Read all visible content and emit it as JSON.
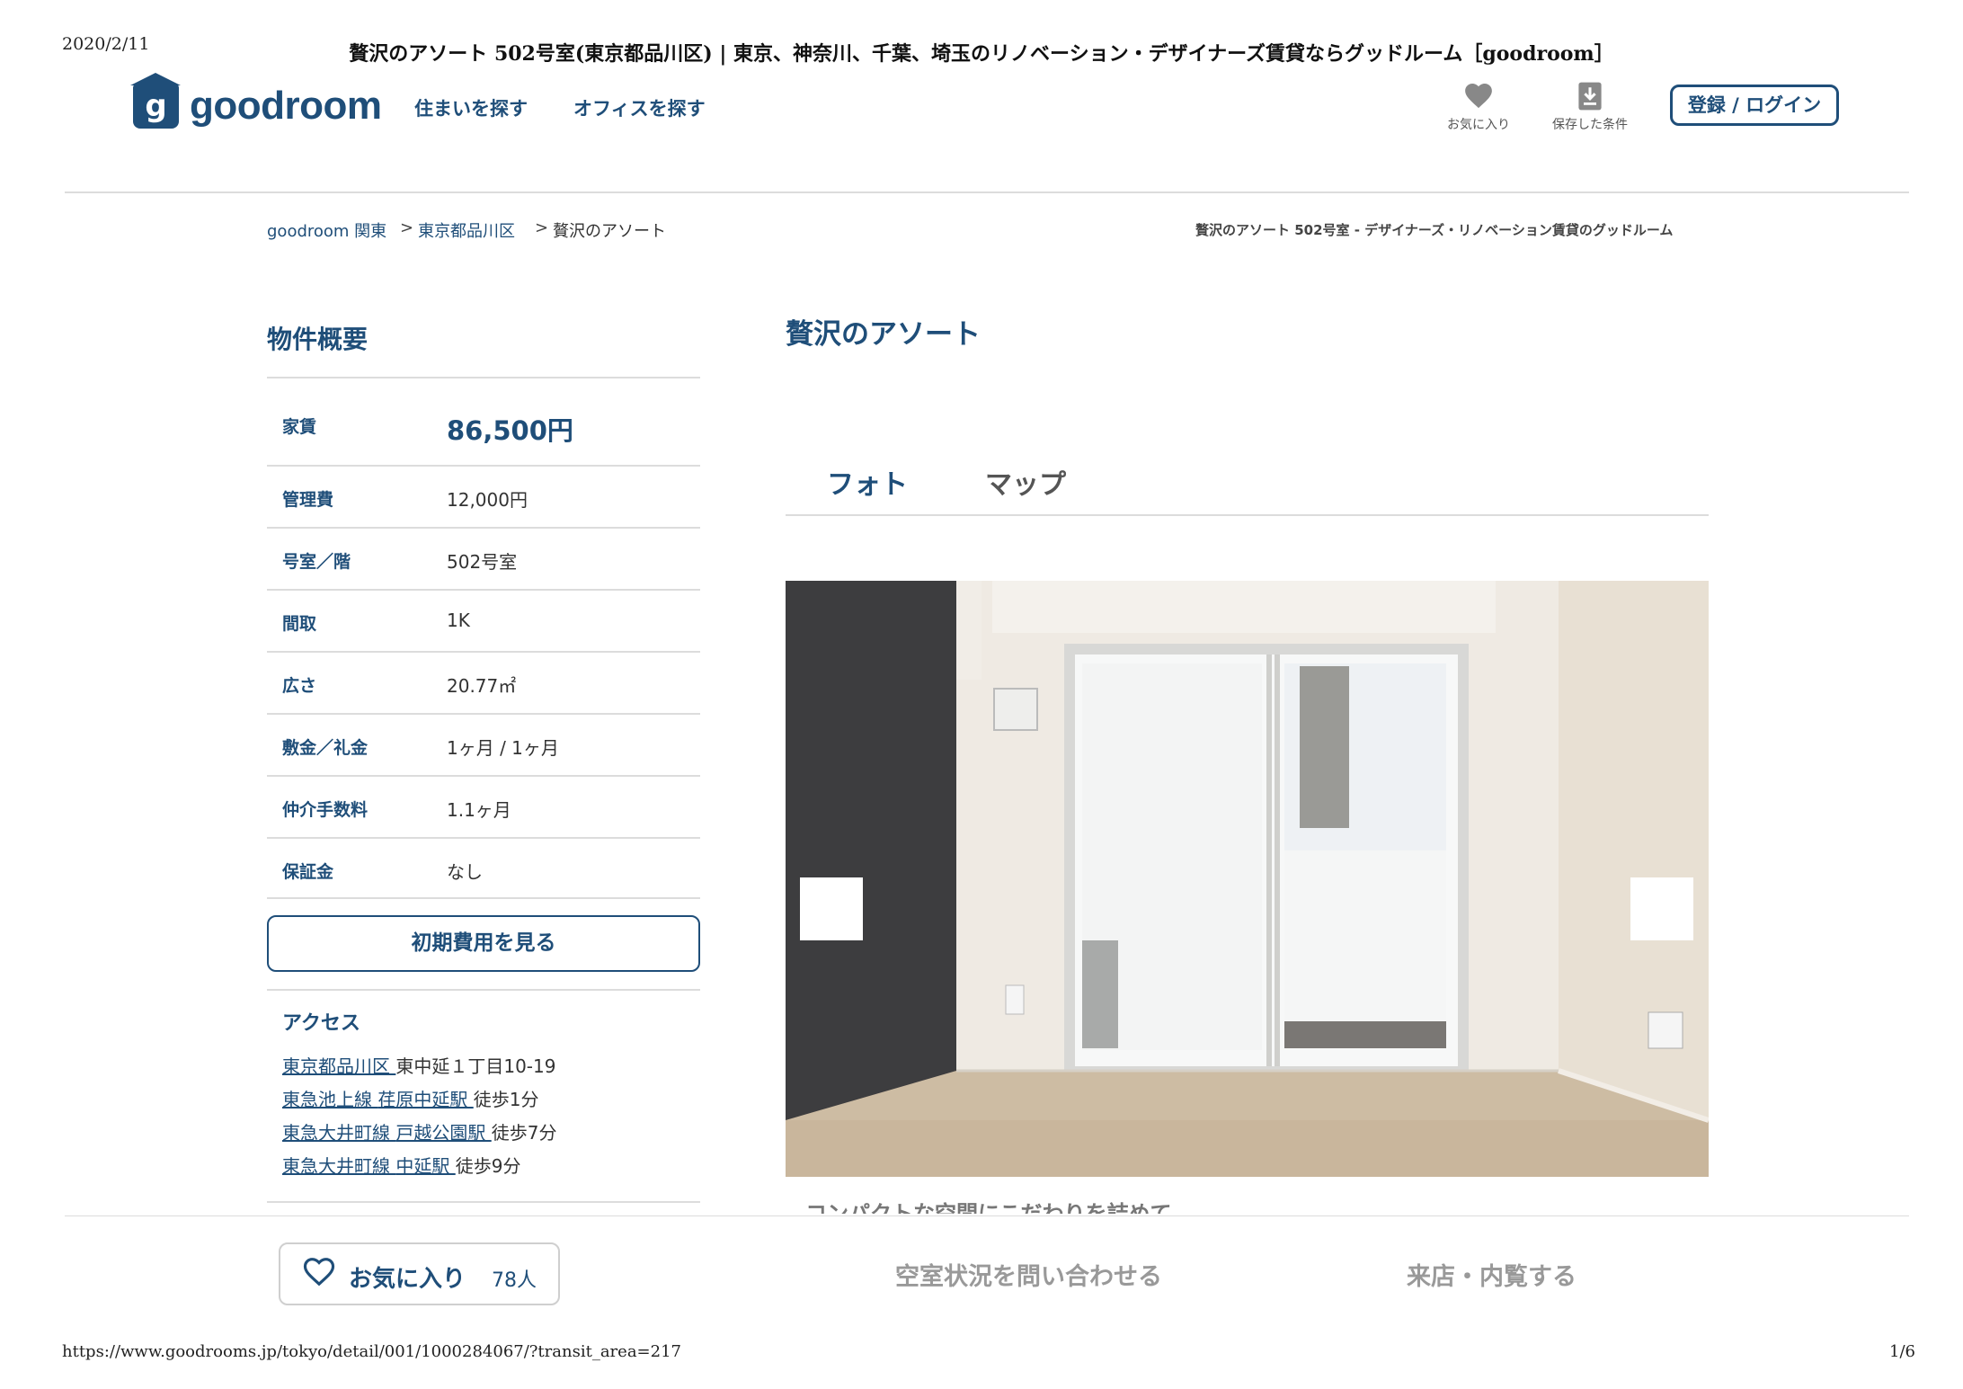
{
  "print": {
    "date": "2020/2/11",
    "title": "贅沢のアソート 502号室(東京都品川区) | 東京、神奈川、千葉、埼玉のリノベーション・デザイナーズ賃貸ならグッドルーム［goodroom］",
    "url": "https://www.goodrooms.jp/tokyo/detail/001/1000284067/?transit_area=217",
    "page": "1/6"
  },
  "header": {
    "logo_mark": "g",
    "logo_text": "goodroom",
    "nav": [
      "住まいを探す",
      "オフィスを探す"
    ],
    "favorites_label": "お気に入り",
    "saved_label": "保存した条件",
    "login_label": "登録 / ログイン"
  },
  "breadcrumb": {
    "items": [
      "goodroom 関東",
      "東京都品川区",
      "贅沢のアソート"
    ],
    "sep": ">",
    "right_title": "贅沢のアソート 502号室 - デザイナーズ・リノベーション賃貸のグッドルーム"
  },
  "overview": {
    "title": "物件概要",
    "rows": [
      {
        "key": "家賃",
        "value": "86,500円"
      },
      {
        "key": "管理費",
        "value": "12,000円"
      },
      {
        "key": "号室／階",
        "value": "502号室"
      },
      {
        "key": "間取",
        "value": "1K"
      },
      {
        "key": "広さ",
        "value": "20.77㎡"
      },
      {
        "key": "敷金／礼金",
        "value": "1ヶ月 / 1ヶ月"
      },
      {
        "key": "仲介手数料",
        "value": "1.1ヶ月"
      },
      {
        "key": "保証金",
        "value": "なし"
      }
    ],
    "cost_button": "初期費用を見る"
  },
  "access": {
    "title": "アクセス",
    "lines": [
      {
        "link1": "東京都品川区",
        "link2": "",
        "text": "東中延１丁目10-19"
      },
      {
        "link1": "東急池上線",
        "link2": "荏原中延駅",
        "text": "徒歩1分"
      },
      {
        "link1": "東急大井町線",
        "link2": "戸越公園駅",
        "text": "徒歩7分"
      },
      {
        "link1": "東急大井町線",
        "link2": "中延駅",
        "text": "徒歩9分"
      }
    ]
  },
  "main": {
    "property_name": "贅沢のアソート",
    "tabs": [
      "フォト",
      "マップ"
    ],
    "active_tab": 0,
    "photo_caption": "コンパクトな空間にこだわりを詰めて"
  },
  "bottom_bar": {
    "favorite_label": "お気に入り",
    "favorite_count": "78人",
    "inquiry_label": "空室状況を問い合わせる",
    "visit_label": "来店・内覧する"
  },
  "colors": {
    "brand": "#1f4e79",
    "border": "#dcdcdc",
    "muted": "#999999"
  }
}
